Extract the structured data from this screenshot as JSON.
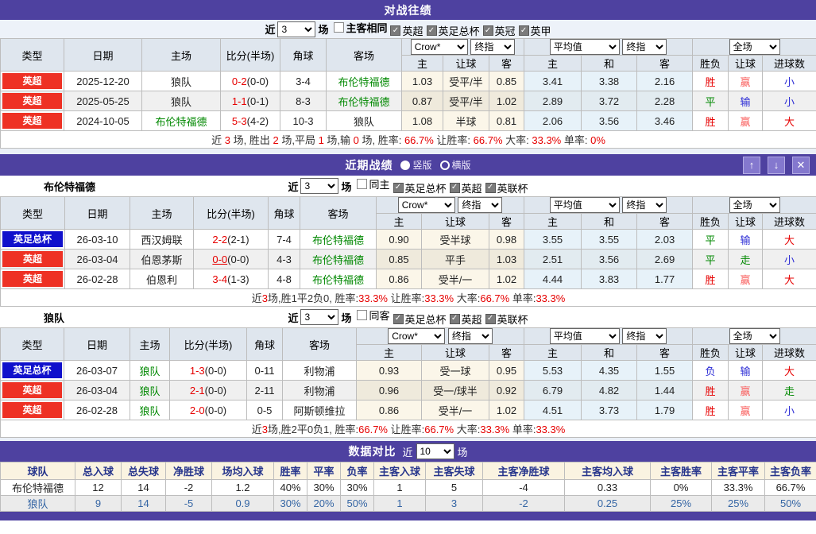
{
  "cols": {
    "type": "类型",
    "date": "日期",
    "home": "主场",
    "score": "比分(半场)",
    "corner": "角球",
    "away": "客场",
    "h": "主",
    "handicap": "让球",
    "a": "客",
    "d": "和",
    "result": "胜负",
    "goals": "进球数",
    "crow": "Crow*",
    "final": "终指",
    "avg": "平均值",
    "full": "全场"
  },
  "h2h": {
    "title": "对战往绩",
    "filter": {
      "near": "近",
      "count": "3",
      "unit": "场",
      "checks": [
        {
          "label": "主客相同",
          "checked": false,
          "bold": true
        },
        {
          "label": "英超",
          "checked": true
        },
        {
          "label": "英足总杯",
          "checked": true
        },
        {
          "label": "英冠",
          "checked": true
        },
        {
          "label": "英甲",
          "checked": true
        }
      ]
    },
    "rows": [
      {
        "league": [
          "英超",
          "red"
        ],
        "date": "2025-12-20",
        "home": "狼队",
        "hg": false,
        "ft": "0-2",
        "ht": "(0-0)",
        "u": false,
        "corner": "3-4",
        "away": "布伦特福德",
        "ag": true,
        "o1": "1.03",
        "hcp": "受平/半",
        "o2": "0.85",
        "a1": "3.41",
        "a2": "3.38",
        "a3": "2.16",
        "r": [
          "胜",
          "red"
        ],
        "hr": [
          "赢",
          "lightred"
        ],
        "g": [
          "小",
          "blue"
        ]
      },
      {
        "league": [
          "英超",
          "red"
        ],
        "date": "2025-05-25",
        "home": "狼队",
        "hg": false,
        "ft": "1-1",
        "ht": "(0-1)",
        "u": false,
        "corner": "8-3",
        "away": "布伦特福德",
        "ag": true,
        "o1": "0.87",
        "hcp": "受平/半",
        "o2": "1.02",
        "a1": "2.89",
        "a2": "3.72",
        "a3": "2.28",
        "r": [
          "平",
          "green"
        ],
        "hr": [
          "输",
          "blue"
        ],
        "g": [
          "小",
          "blue"
        ]
      },
      {
        "league": [
          "英超",
          "red"
        ],
        "date": "2024-10-05",
        "home": "布伦特福德",
        "hg": true,
        "ft": "5-3",
        "ht": "(4-2)",
        "u": false,
        "corner": "10-3",
        "away": "狼队",
        "ag": false,
        "o1": "1.08",
        "hcp": "半球",
        "o2": "0.81",
        "a1": "2.06",
        "a2": "3.56",
        "a3": "3.46",
        "r": [
          "胜",
          "red"
        ],
        "hr": [
          "赢",
          "lightred"
        ],
        "g": [
          "大",
          "red"
        ]
      }
    ],
    "summary": [
      {
        "t": "近 "
      },
      {
        "t": "3",
        "r": 1
      },
      {
        "t": " 场, 胜出 "
      },
      {
        "t": "2",
        "r": 1
      },
      {
        "t": " 场,平局 "
      },
      {
        "t": "1",
        "r": 1
      },
      {
        "t": " 场,输 "
      },
      {
        "t": "0",
        "r": 1
      },
      {
        "t": " 场, 胜率: "
      },
      {
        "t": "66.7%",
        "r": 1
      },
      {
        "t": " 让胜率: "
      },
      {
        "t": "66.7%",
        "r": 1
      },
      {
        "t": " 大率: "
      },
      {
        "t": "33.3%",
        "r": 1
      },
      {
        "t": " 单率: "
      },
      {
        "t": "0%",
        "r": 1
      }
    ]
  },
  "recent": {
    "title": "近期战绩",
    "vertical": "竖版",
    "horizontal": "横版",
    "icons": {
      "up": "↑",
      "down": "↓",
      "close": "✕"
    },
    "teams": [
      {
        "name": "布伦特福德",
        "filter": {
          "near": "近",
          "count": "3",
          "unit": "场",
          "checks": [
            {
              "label": "同主",
              "checked": false
            },
            {
              "label": "英足总杯",
              "checked": true
            },
            {
              "label": "英超",
              "checked": true
            },
            {
              "label": "英联杯",
              "checked": true
            }
          ]
        },
        "rows": [
          {
            "league": [
              "英足总杯",
              "blue"
            ],
            "date": "26-03-10",
            "home": "西汉姆联",
            "hg": false,
            "ft": "2-2",
            "ht": "(2-1)",
            "u": false,
            "corner": "7-4",
            "away": "布伦特福德",
            "ag": true,
            "o1": "0.90",
            "hcp": "受半球",
            "o2": "0.98",
            "a1": "3.55",
            "a2": "3.55",
            "a3": "2.03",
            "r": [
              "平",
              "green"
            ],
            "hr": [
              "输",
              "blue"
            ],
            "g": [
              "大",
              "red"
            ]
          },
          {
            "league": [
              "英超",
              "red"
            ],
            "date": "26-03-04",
            "home": "伯恩茅斯",
            "hg": false,
            "ft": "0-0",
            "ht": "(0-0)",
            "u": true,
            "corner": "4-3",
            "away": "布伦特福德",
            "ag": true,
            "o1": "0.85",
            "hcp": "平手",
            "o2": "1.03",
            "a1": "2.51",
            "a2": "3.56",
            "a3": "2.69",
            "r": [
              "平",
              "green"
            ],
            "hr": [
              "走",
              "green"
            ],
            "g": [
              "小",
              "blue"
            ]
          },
          {
            "league": [
              "英超",
              "red"
            ],
            "date": "26-02-28",
            "home": "伯恩利",
            "hg": false,
            "ft": "3-4",
            "ht": "(1-3)",
            "u": false,
            "corner": "4-8",
            "away": "布伦特福德",
            "ag": true,
            "o1": "0.86",
            "hcp": "受半/一",
            "o2": "1.02",
            "a1": "4.44",
            "a2": "3.83",
            "a3": "1.77",
            "r": [
              "胜",
              "red"
            ],
            "hr": [
              "赢",
              "lightred"
            ],
            "g": [
              "大",
              "red"
            ]
          }
        ],
        "summary": [
          {
            "t": "近"
          },
          {
            "t": "3",
            "r": 1
          },
          {
            "t": "场,胜1平2负0, 胜率:"
          },
          {
            "t": "33.3%",
            "r": 1
          },
          {
            "t": " 让胜率:"
          },
          {
            "t": "33.3%",
            "r": 1
          },
          {
            "t": " 大率:"
          },
          {
            "t": "66.7%",
            "r": 1
          },
          {
            "t": " 单率:"
          },
          {
            "t": "33.3%",
            "r": 1
          }
        ]
      },
      {
        "name": "狼队",
        "filter": {
          "near": "近",
          "count": "3",
          "unit": "场",
          "checks": [
            {
              "label": "同客",
              "checked": false
            },
            {
              "label": "英足总杯",
              "checked": true
            },
            {
              "label": "英超",
              "checked": true
            },
            {
              "label": "英联杯",
              "checked": true
            }
          ]
        },
        "rows": [
          {
            "league": [
              "英足总杯",
              "blue"
            ],
            "date": "26-03-07",
            "home": "狼队",
            "hg": true,
            "ft": "1-3",
            "ht": "(0-0)",
            "u": false,
            "corner": "0-11",
            "away": "利物浦",
            "ag": false,
            "o1": "0.93",
            "hcp": "受一球",
            "o2": "0.95",
            "a1": "5.53",
            "a2": "4.35",
            "a3": "1.55",
            "r": [
              "负",
              "blue"
            ],
            "hr": [
              "输",
              "blue"
            ],
            "g": [
              "大",
              "red"
            ]
          },
          {
            "league": [
              "英超",
              "red"
            ],
            "date": "26-03-04",
            "home": "狼队",
            "hg": true,
            "ft": "2-1",
            "ht": "(0-0)",
            "u": false,
            "corner": "2-11",
            "away": "利物浦",
            "ag": false,
            "o1": "0.96",
            "hcp": "受一/球半",
            "o2": "0.92",
            "a1": "6.79",
            "a2": "4.82",
            "a3": "1.44",
            "r": [
              "胜",
              "red"
            ],
            "hr": [
              "赢",
              "lightred"
            ],
            "g": [
              "走",
              "green"
            ]
          },
          {
            "league": [
              "英超",
              "red"
            ],
            "date": "26-02-28",
            "home": "狼队",
            "hg": true,
            "ft": "2-0",
            "ht": "(0-0)",
            "u": false,
            "corner": "0-5",
            "away": "阿斯顿维拉",
            "ag": false,
            "o1": "0.86",
            "hcp": "受半/一",
            "o2": "1.02",
            "a1": "4.51",
            "a2": "3.73",
            "a3": "1.79",
            "r": [
              "胜",
              "red"
            ],
            "hr": [
              "赢",
              "lightred"
            ],
            "g": [
              "小",
              "blue"
            ]
          }
        ],
        "summary": [
          {
            "t": "近"
          },
          {
            "t": "3",
            "r": 1
          },
          {
            "t": "场,胜2平0负1, 胜率:"
          },
          {
            "t": "66.7%",
            "r": 1
          },
          {
            "t": " 让胜率:"
          },
          {
            "t": "66.7%",
            "r": 1
          },
          {
            "t": " 大率:"
          },
          {
            "t": "33.3%",
            "r": 1
          },
          {
            "t": " 单率:"
          },
          {
            "t": "33.3%",
            "r": 1
          }
        ]
      }
    ]
  },
  "compare": {
    "title": "数据对比",
    "near": "近",
    "count": "10",
    "unit": "场",
    "headers": [
      "球队",
      "总入球",
      "总失球",
      "净胜球",
      "场均入球",
      "胜率",
      "平率",
      "负率",
      "主客入球",
      "主客失球",
      "主客净胜球",
      "主客均入球",
      "主客胜率",
      "主客平率",
      "主客负率"
    ],
    "rows": [
      {
        "name": "布伦特福德",
        "blue": false,
        "values": [
          "12",
          "14",
          "-2",
          "1.2",
          "40%",
          "30%",
          "30%",
          "1",
          "5",
          "-4",
          "0.33",
          "0%",
          "33.3%",
          "66.7%"
        ]
      },
      {
        "name": "狼队",
        "blue": true,
        "values": [
          "9",
          "14",
          "-5",
          "0.9",
          "30%",
          "20%",
          "50%",
          "1",
          "3",
          "-2",
          "0.25",
          "25%",
          "25%",
          "50%"
        ]
      }
    ]
  }
}
